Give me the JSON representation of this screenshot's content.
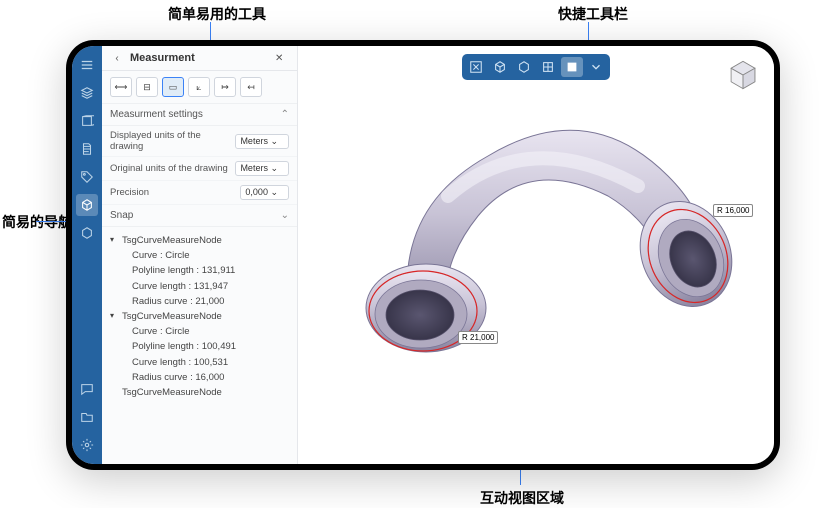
{
  "callouts": {
    "tools": "简单易用的工具",
    "quickbar": "快捷工具栏",
    "nav": "简易的导航",
    "viewport": "互动视图区域"
  },
  "panel": {
    "title": "Measurment",
    "settings_header": "Measurment settings",
    "displayed_units_label": "Displayed units of the drawing",
    "displayed_units_value": "Meters",
    "original_units_label": "Original units of the drawing",
    "original_units_value": "Meters",
    "precision_label": "Precision",
    "precision_value": "0,000",
    "snap_header": "Snap"
  },
  "tree": {
    "nodes": [
      {
        "name": "TsgCurveMeasureNode",
        "children": [
          "Curve : Circle",
          "Polyline length : 131,911",
          "Curve length : 131,947",
          "Radius curve : 21,000"
        ]
      },
      {
        "name": "TsgCurveMeasureNode",
        "children": [
          "Curve : Circle",
          "Polyline length : 100,491",
          "Curve length : 100,531",
          "Radius curve : 16,000"
        ]
      },
      {
        "name": "TsgCurveMeasureNode",
        "children": []
      }
    ]
  },
  "measurements": {
    "left": "R 21,000",
    "right": "R 16,000"
  },
  "icons": {
    "nav": [
      "menu",
      "layers",
      "shape",
      "document",
      "tag",
      "cube",
      "cube2"
    ],
    "nav_bottom": [
      "chat",
      "folder",
      "settings"
    ],
    "tools": [
      "dist",
      "dim1",
      "dim2",
      "angle",
      "point1",
      "point2"
    ],
    "quickbar": [
      "fit",
      "box",
      "iso",
      "wireframe",
      "shaded",
      "more"
    ]
  },
  "colors": {
    "primary": "#2563a0",
    "callout_line": "#3b82f6",
    "pipe_fill": "#c8c3d6",
    "pipe_edge": "#7a7596",
    "measure_circle": "#d92626"
  }
}
